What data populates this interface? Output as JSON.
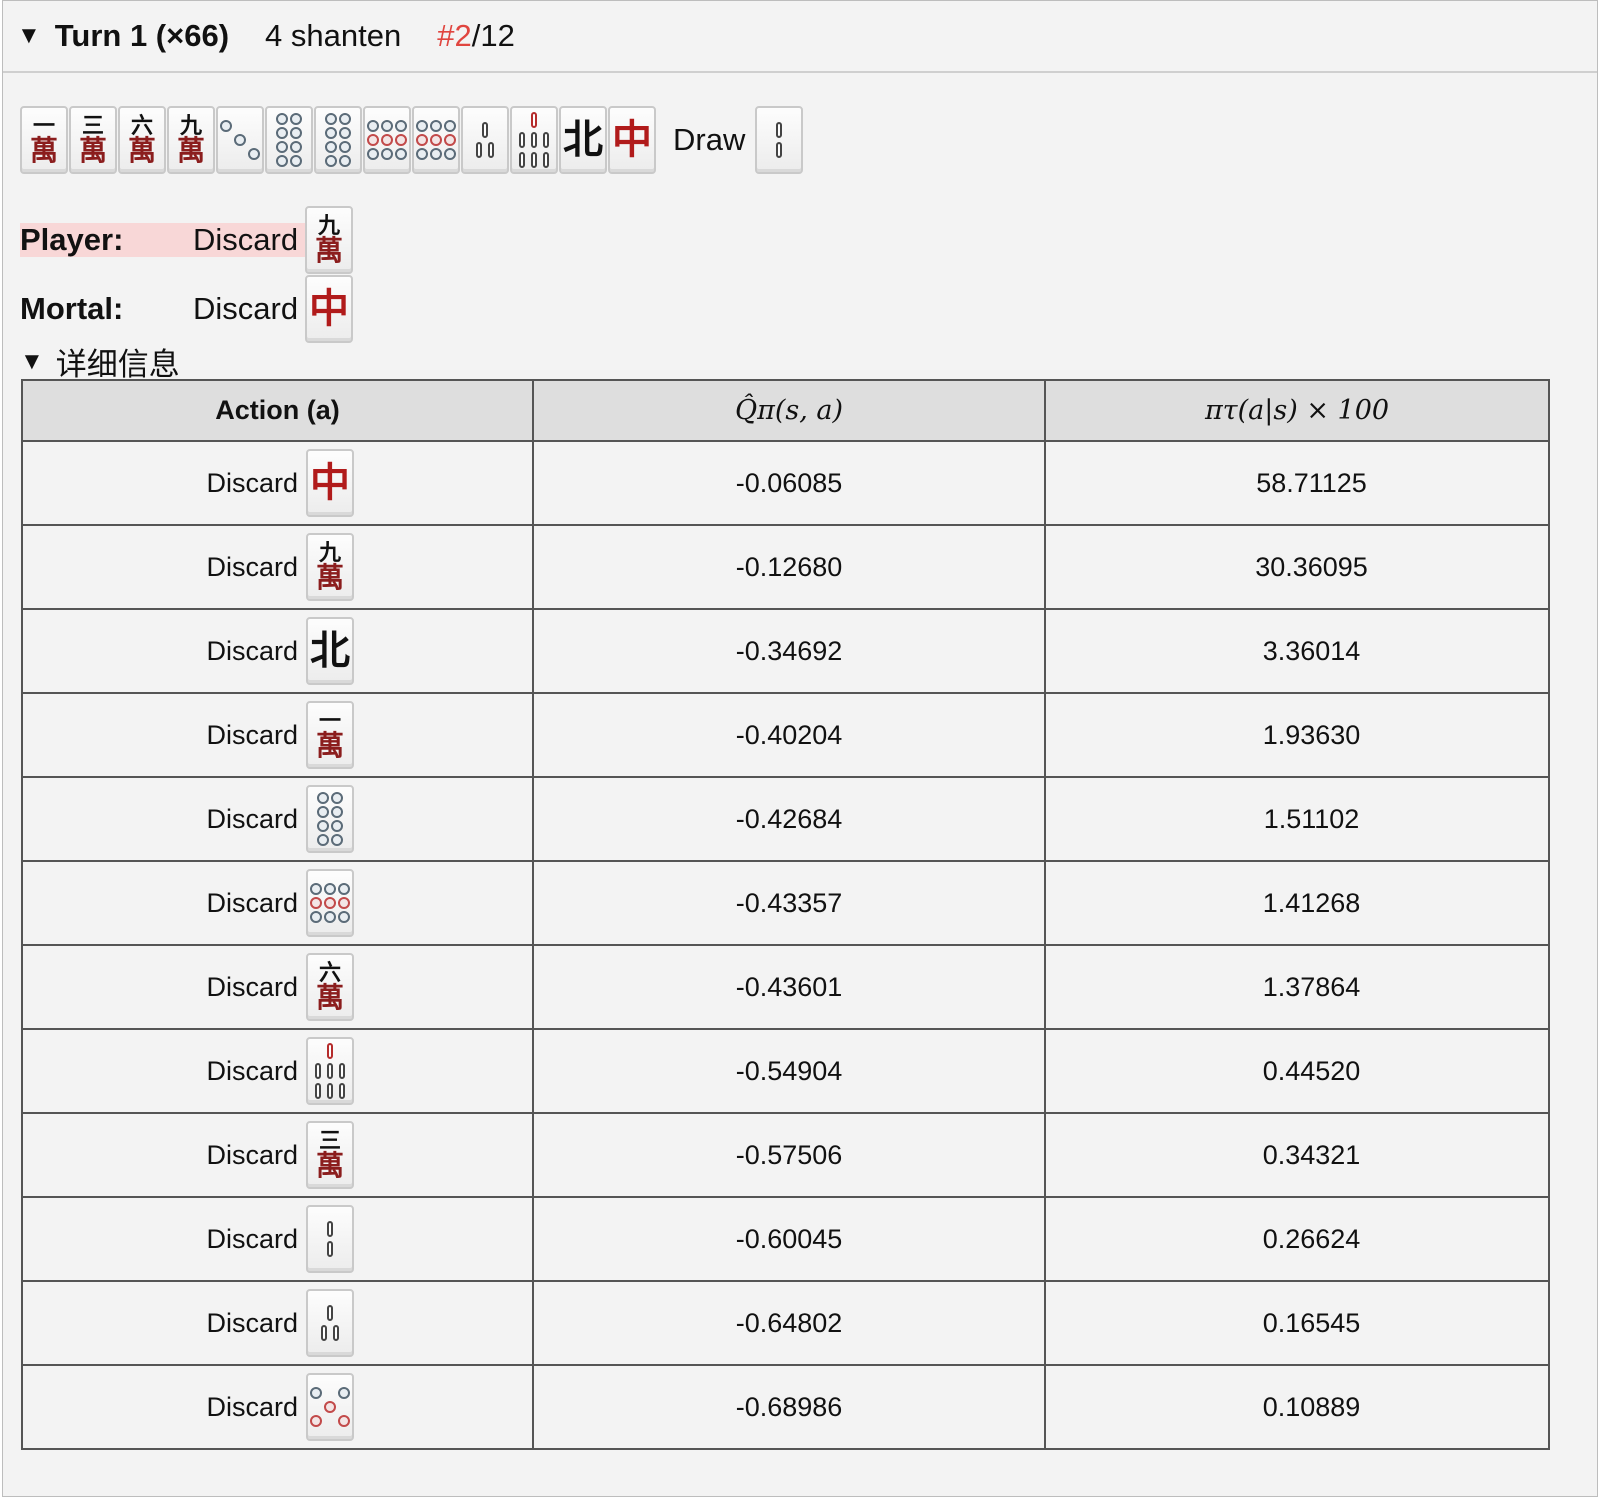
{
  "summary": {
    "toggle": "▼",
    "turn": "Turn 1 (×66)",
    "shanten": "4 shanten",
    "rank_prefix": "#",
    "rank": "2",
    "total": "/12"
  },
  "hand": {
    "tiles": [
      "1m",
      "3m",
      "6m",
      "9m",
      "3p",
      "8p",
      "8p",
      "9p",
      "9p",
      "3s",
      "7s",
      "north",
      "chun"
    ],
    "draw_label": "Draw",
    "draw_tile": "2s"
  },
  "player": {
    "label": "Player:",
    "action": "Discard",
    "tile": "9m"
  },
  "mortal": {
    "label": "Mortal:",
    "action": "Discard",
    "tile": "chun"
  },
  "details": {
    "toggle": "▼",
    "label": "详细信息"
  },
  "table": {
    "headers": [
      "Action (a)",
      "Q̂π(s, a)",
      "πτ(a|s) × 100"
    ],
    "rows": [
      {
        "action": "Discard",
        "tile": "chun",
        "q": "-0.06085",
        "p": "58.71125"
      },
      {
        "action": "Discard",
        "tile": "9m",
        "q": "-0.12680",
        "p": "30.36095"
      },
      {
        "action": "Discard",
        "tile": "north",
        "q": "-0.34692",
        "p": "3.36014"
      },
      {
        "action": "Discard",
        "tile": "1m",
        "q": "-0.40204",
        "p": "1.93630"
      },
      {
        "action": "Discard",
        "tile": "8p",
        "q": "-0.42684",
        "p": "1.51102"
      },
      {
        "action": "Discard",
        "tile": "9p",
        "q": "-0.43357",
        "p": "1.41268"
      },
      {
        "action": "Discard",
        "tile": "6m",
        "q": "-0.43601",
        "p": "1.37864"
      },
      {
        "action": "Discard",
        "tile": "7s",
        "q": "-0.54904",
        "p": "0.44520"
      },
      {
        "action": "Discard",
        "tile": "3m",
        "q": "-0.57506",
        "p": "0.34321"
      },
      {
        "action": "Discard",
        "tile": "2s",
        "q": "-0.60045",
        "p": "0.26624"
      },
      {
        "action": "Discard",
        "tile": "3s",
        "q": "-0.64802",
        "p": "0.16545"
      },
      {
        "action": "Discard",
        "tile": "5p",
        "q": "-0.68986",
        "p": "0.10889"
      }
    ]
  },
  "tile_glyphs": {
    "1m": {
      "top": "一",
      "bottom": "萬"
    },
    "3m": {
      "top": "三",
      "bottom": "萬"
    },
    "6m": {
      "top": "六",
      "bottom": "萬"
    },
    "9m": {
      "top": "九",
      "bottom": "萬"
    },
    "north": {
      "char": "北"
    },
    "chun": {
      "char": "中"
    }
  },
  "colors": {
    "accent": "#e0453f",
    "highlight": "#f8d7d7",
    "man_red": "#8b1d1d"
  }
}
